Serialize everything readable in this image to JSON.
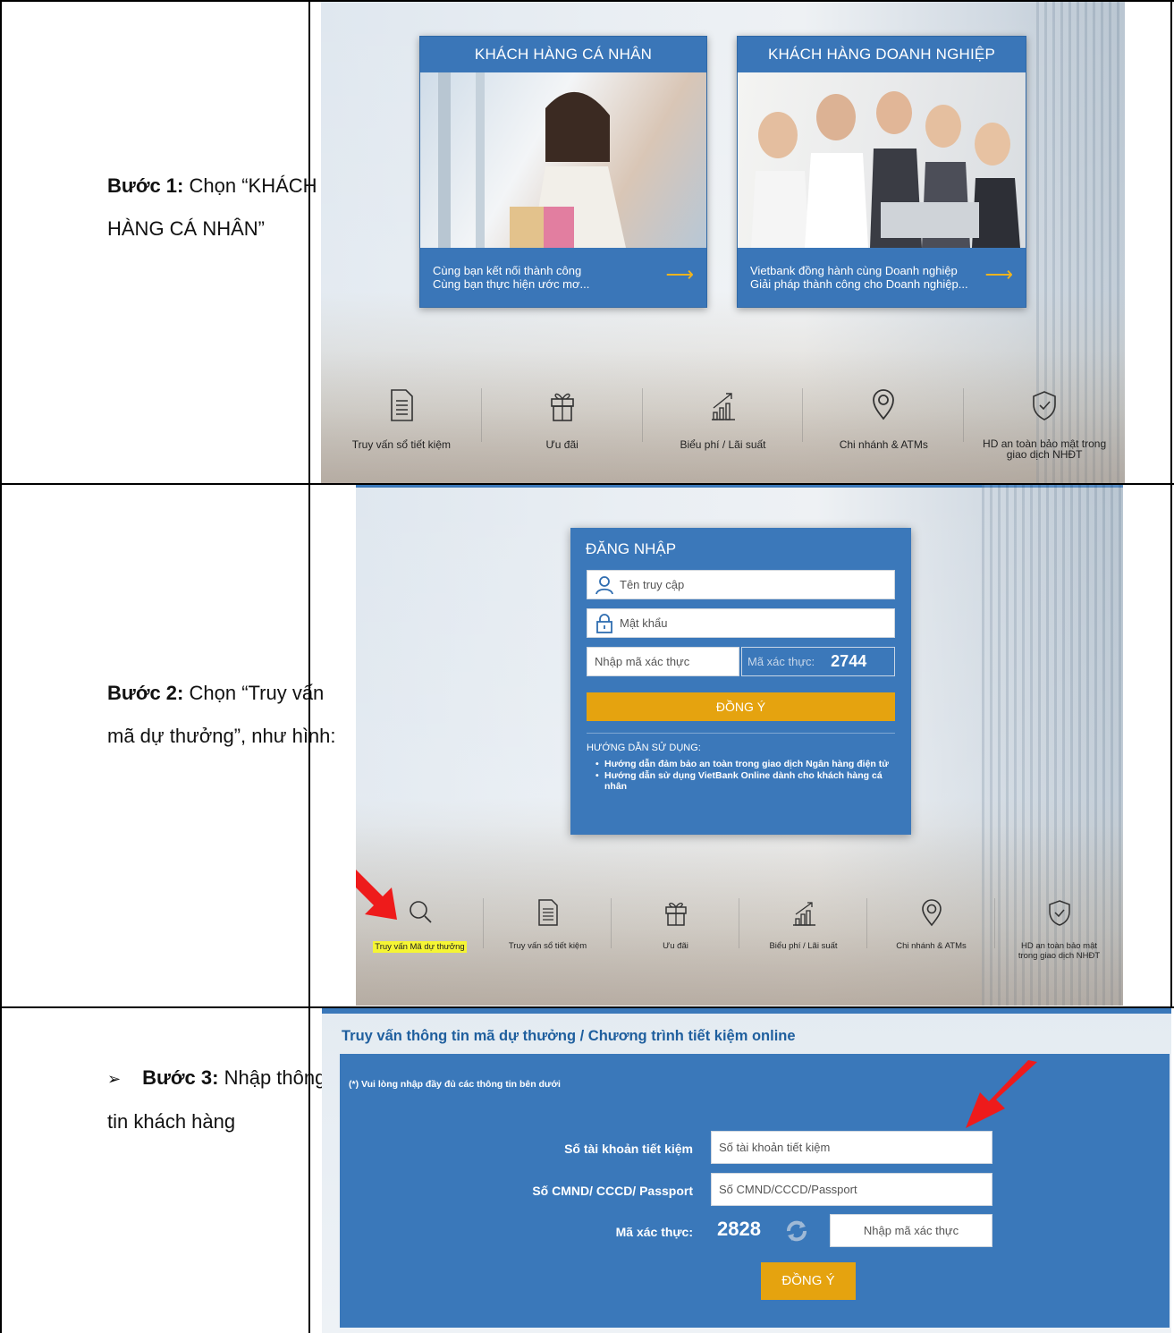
{
  "steps": [
    {
      "prefix": "",
      "label_bold": "Bước 1:",
      "line1_rest": " Chọn “KHÁCH",
      "line2": "HÀNG CÁ NHÂN”"
    },
    {
      "prefix": "",
      "label_bold": "Bước 2:",
      "line1_rest": " Chọn “Truy vấn",
      "line2": "mã dự thưởng”, như hình:"
    },
    {
      "prefix": "➢",
      "label_bold": "Bước 3:",
      "line1_rest": " Nhập thông",
      "line2": "tin khách hàng"
    }
  ],
  "shot1": {
    "card_personal": {
      "title": "KHÁCH HÀNG CÁ NHÂN",
      "line1": "Cùng bạn kết nối thành công",
      "line2": "Cùng bạn thực hiện ước mơ..."
    },
    "card_business": {
      "title": "KHÁCH HÀNG DOANH NGHIỆP",
      "line1": "Vietbank đồng hành cùng Doanh nghiệp",
      "line2": "Giải pháp thành công cho Doanh nghiệp..."
    },
    "icons": [
      {
        "icon": "document-icon",
        "label": "Truy vấn sổ tiết kiệm"
      },
      {
        "icon": "gift-icon",
        "label": "Ưu đãi"
      },
      {
        "icon": "chart-icon",
        "label": "Biểu phí / Lãi suất"
      },
      {
        "icon": "location-pin-icon",
        "label": "Chi nhánh & ATMs"
      },
      {
        "icon": "shield-check-icon",
        "label": "HD an toàn bảo mật trong",
        "label2": "giao dịch NHĐT"
      }
    ]
  },
  "shot2": {
    "login_title": "ĐĂNG NHẬP",
    "username_placeholder": "Tên truy cập",
    "password_placeholder": "Mật khẩu",
    "captcha_placeholder": "Nhập mã xác thực",
    "captcha_label": "Mã xác thực:",
    "captcha_code": "2744",
    "submit_label": "ĐỒNG Ý",
    "guide_title": "HƯỚNG DẪN SỬ DỤNG:",
    "guide_items": [
      "Hướng dẫn đảm bảo an toàn trong giao dịch Ngân hàng điện tử",
      "Hướng dẫn sử dụng VietBank Online dành cho khách hàng cá nhân"
    ],
    "icons": [
      {
        "icon": "search-icon",
        "label": "Truy vấn Mã dự thưởng"
      },
      {
        "icon": "document-icon",
        "label": "Truy vấn sổ tiết kiệm"
      },
      {
        "icon": "gift-icon",
        "label": "Ưu đãi"
      },
      {
        "icon": "chart-icon",
        "label": "Biểu phí / Lãi suất"
      },
      {
        "icon": "location-pin-icon",
        "label": "Chi nhánh & ATMs"
      },
      {
        "icon": "shield-check-icon",
        "label": "HD an toàn bảo mật",
        "label2": "trong giao dịch NHĐT"
      }
    ],
    "highlight_color": "#f5f534"
  },
  "shot3": {
    "heading": "Truy vấn thông tin mã dự thưởng / Chương trình tiết kiệm online",
    "note": "(*) Vui lòng nhập đầy đủ các thông tin bên dưới",
    "account_label": "Số tài khoản tiết kiệm",
    "account_placeholder": "Số tài khoản tiết kiệm",
    "id_label": "Số CMND/ CCCD/ Passport",
    "id_placeholder": "Số CMND/CCCD/Passport",
    "captcha_label": "Mã xác thực:",
    "captcha_code": "2828",
    "captcha_placeholder": "Nhập mã xác thực",
    "submit_label": "ĐỒNG Ý"
  },
  "colors": {
    "brand_blue": "#3a78ba",
    "button_yellow": "#e5a30f",
    "arrow_red": "#ee1b1b",
    "heading_blue": "#1f5f9e"
  }
}
